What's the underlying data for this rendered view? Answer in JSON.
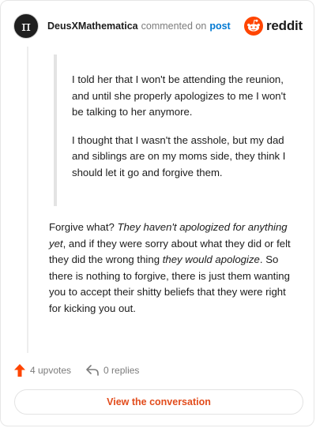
{
  "header": {
    "username": "DeusXMathematica",
    "commented_text": "commented on",
    "post_link": "post",
    "brand": "reddit",
    "avatar_symbol": "π"
  },
  "quote": {
    "paragraphs": [
      "I told her that I won't be attending the reunion, and until she properly apologizes to me I won't be talking to her anymore.",
      "I thought that I wasn't the asshole, but my dad and siblings are on my moms side, they think I should let it go and forgive them."
    ]
  },
  "comment": {
    "part1": "Forgive what? ",
    "part2_italic": "They haven't apologized for anything yet",
    "part3": ", and if they were sorry about what they did or felt they did the wrong thing ",
    "part4_italic": "they would apologize",
    "part5": ". So there is nothing to forgive, there is just them wanting you to accept their shitty beliefs that they were right for kicking you out."
  },
  "actions": {
    "upvotes": "4 upvotes",
    "replies": "0 replies"
  },
  "cta": {
    "label": "View the conversation"
  },
  "colors": {
    "brand_orange": "#ff4500",
    "link_blue": "#0079d3",
    "cta_text": "#e24c1c"
  }
}
